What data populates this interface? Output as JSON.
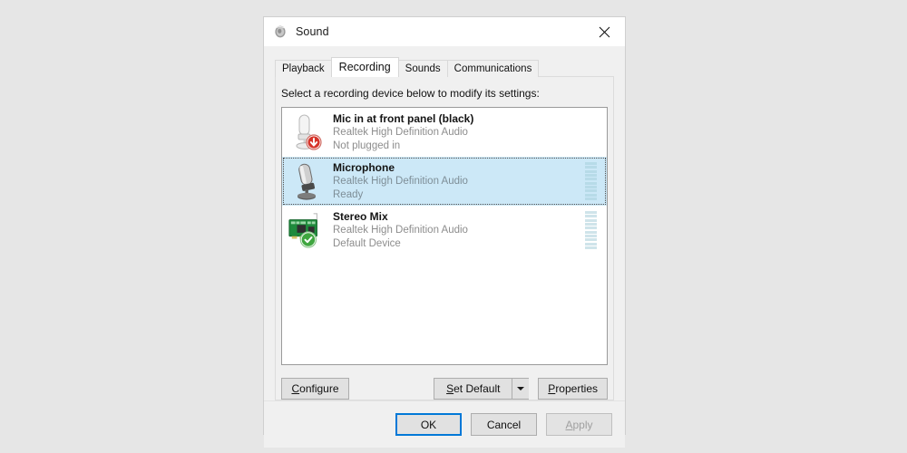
{
  "window": {
    "title": "Sound",
    "icon": "speaker-icon",
    "close_label": "✕"
  },
  "tabs": [
    {
      "label": "Playback",
      "selected": false
    },
    {
      "label": "Recording",
      "selected": true
    },
    {
      "label": "Sounds",
      "selected": false
    },
    {
      "label": "Communications",
      "selected": false
    }
  ],
  "recording_tab": {
    "prompt": "Select a recording device below to modify its settings:",
    "devices": [
      {
        "name": "Mic in at front panel (black)",
        "driver": "Realtek High Definition Audio",
        "state": "Not plugged in",
        "icon": "microphone-disabled-icon",
        "badge": "red-down-arrow-badge",
        "selected": false,
        "meter_segments": 0,
        "meter_style": "none"
      },
      {
        "name": "Microphone",
        "driver": "Realtek High Definition Audio",
        "state": "Ready",
        "icon": "microphone-icon",
        "badge": "none",
        "selected": true,
        "meter_segments": 10,
        "meter_style": "normal"
      },
      {
        "name": "Stereo Mix",
        "driver": "Realtek High Definition Audio",
        "state": "Default Device",
        "icon": "sound-card-icon",
        "badge": "green-check-badge",
        "selected": false,
        "meter_segments": 10,
        "meter_style": "faint"
      }
    ],
    "buttons": {
      "configure": {
        "label": "Configure",
        "accel": "C",
        "enabled": true
      },
      "set_default": {
        "label": "Set Default",
        "accel": "S",
        "enabled": true,
        "has_dropdown": true
      },
      "properties": {
        "label": "Properties",
        "accel": "P",
        "enabled": true
      }
    }
  },
  "footer": {
    "ok": {
      "label": "OK",
      "enabled": true,
      "default": true
    },
    "cancel": {
      "label": "Cancel",
      "enabled": true,
      "default": false
    },
    "apply": {
      "label": "Apply",
      "accel": "A",
      "enabled": false,
      "default": false
    }
  },
  "colors": {
    "selection_bg": "#cce8f7",
    "accent": "#0078d7",
    "meter": "#b7dbe8",
    "badge_red": "#d6342a",
    "badge_green": "#3fa63f",
    "dialog_bg": "#f0f0f0",
    "page_bg": "#e6e6e6"
  }
}
